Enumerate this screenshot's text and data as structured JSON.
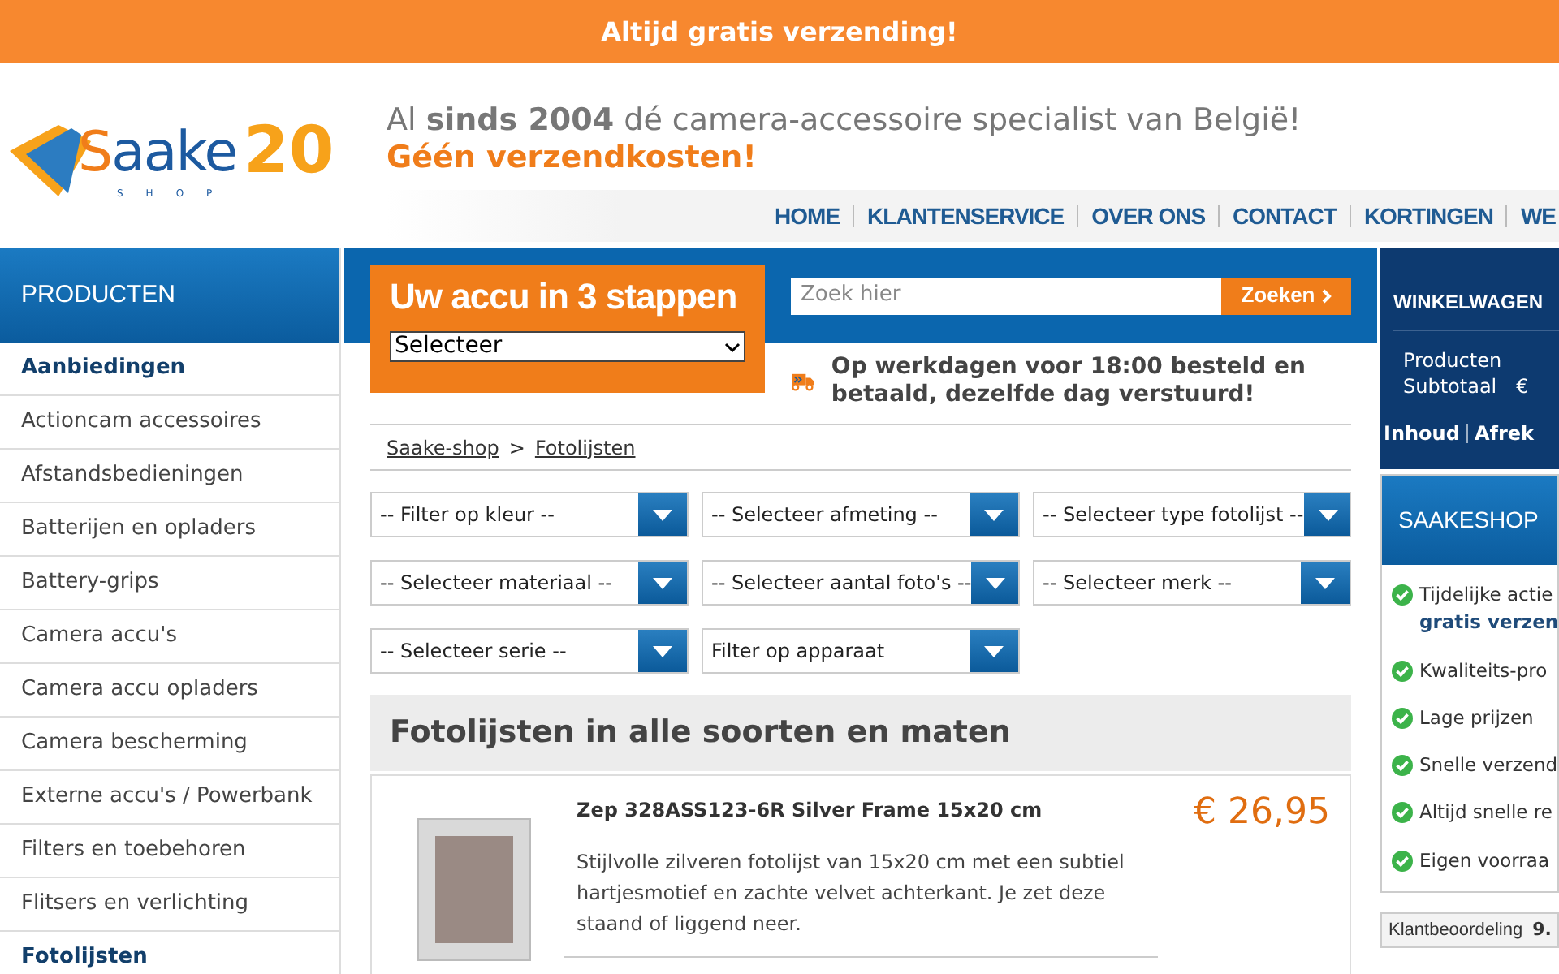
{
  "banner": "Altijd gratis verzending!",
  "logo": {
    "word": "Saake",
    "number": "20",
    "sub": "SHOP"
  },
  "tagline": "Al **sinds 2004** dé camera-accessoire specialist van België!",
  "tagline_sub": "Géén verzendkosten!",
  "nav": [
    "HOME",
    "KLANTENSERVICE",
    "OVER ONS",
    "CONTACT",
    "KORTINGEN",
    "WE"
  ],
  "sidebar": {
    "title": "PRODUCTEN",
    "items": [
      {
        "label": "Aanbiedingen",
        "selected": true
      },
      {
        "label": "Actioncam accessoires",
        "selected": false
      },
      {
        "label": "Afstandsbedieningen",
        "selected": false
      },
      {
        "label": "Batterijen en opladers",
        "selected": false
      },
      {
        "label": "Battery-grips",
        "selected": false
      },
      {
        "label": "Camera accu's",
        "selected": false
      },
      {
        "label": "Camera accu opladers",
        "selected": false
      },
      {
        "label": "Camera bescherming",
        "selected": false
      },
      {
        "label": "Externe accu's / Powerbank",
        "selected": false
      },
      {
        "label": "Filters en toebehoren",
        "selected": false
      },
      {
        "label": "Flitsers en verlichting",
        "selected": false
      },
      {
        "label": "Fotolijsten",
        "selected": true
      }
    ]
  },
  "accu": {
    "title": "Uw accu in 3 stappen",
    "select": "Selecteer"
  },
  "search": {
    "placeholder": "Zoek hier",
    "button": "Zoeken"
  },
  "delivery": "Op werkdagen voor 18:00 besteld en betaald, dezelfde dag verstuurd!",
  "breadcrumb": [
    {
      "label": "Saake-shop"
    },
    {
      "label": "Fotolijsten"
    }
  ],
  "breadcrumb_separator": ">",
  "filters": [
    "-- Filter op kleur --",
    "-- Selecteer afmeting --",
    "-- Selecteer type fotolijst --",
    "-- Selecteer materiaal --",
    "-- Selecteer aantal foto's --",
    "-- Selecteer merk --",
    "-- Selecteer serie --",
    "Filter op apparaat"
  ],
  "heading": "Fotolijsten in alle soorten en maten",
  "products": [
    {
      "title": "Zep 328ASS123-6R Silver Frame 15x20 cm",
      "price": "€ 26,95",
      "description": "Stijlvolle zilveren fotolijst van 15x20 cm met een subtiel hartjesmotief en zachte velvet achterkant. Je zet deze staand of liggend neer."
    }
  ],
  "cart": {
    "title": "WINKELWAGEN",
    "rows": [
      {
        "label": "Producten",
        "value": ""
      },
      {
        "label": "Subtotaal",
        "value": "€"
      }
    ],
    "links": [
      "Inhoud",
      "Afrek"
    ]
  },
  "usp": {
    "title": "SAAKESHOP",
    "items": [
      {
        "text": "Tijdelijke actie",
        "bold": "gratis verzen"
      },
      {
        "text": "Kwaliteits-pro"
      },
      {
        "text": "Lage prijzen"
      },
      {
        "text": "Snelle verzend"
      },
      {
        "text": "Altijd snelle re"
      },
      {
        "text": "Eigen voorraa"
      }
    ]
  },
  "rating": {
    "label": "Klantbeoordeling",
    "value": "9."
  }
}
